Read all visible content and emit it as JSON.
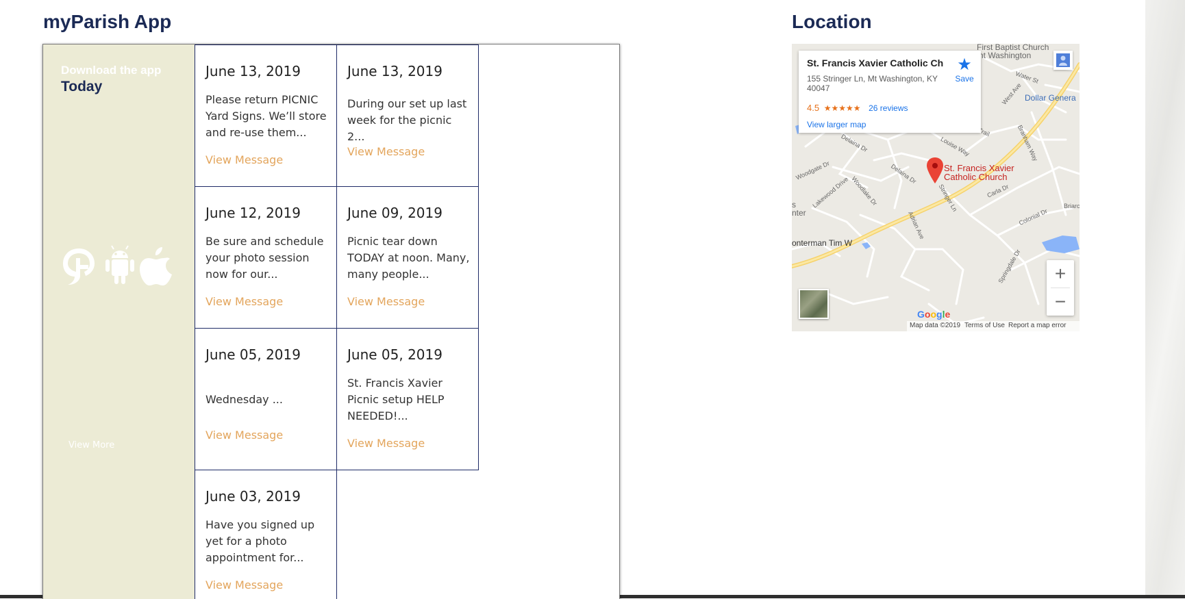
{
  "headings": {
    "app": "myParish App",
    "location": "Location"
  },
  "download": {
    "line1": "Download the app",
    "line2": "Today",
    "view_more": "View More"
  },
  "messages": [
    {
      "date": "June 13, 2019",
      "text": "Please return PICNIC Yard Signs. We’ll store and re-use them...",
      "link": "View Message"
    },
    {
      "date": "June 13, 2019",
      "text": "During our set up last week for the picnic 2...",
      "link": "View Message"
    },
    {
      "date": "June 12, 2019",
      "text": "Be sure and schedule your photo session now for our...",
      "link": "View Message"
    },
    {
      "date": "June 09, 2019",
      "text": "Picnic tear down TODAY at noon. Many, many people...",
      "link": "View Message"
    },
    {
      "date": "June 05, 2019",
      "text": "Wednesday ...",
      "link": "View Message"
    },
    {
      "date": "June 05, 2019",
      "text": "St. Francis Xavier Picnic setup HELP NEEDED!...",
      "link": "View Message"
    },
    {
      "date": "June 03, 2019",
      "text": "Have you signed up yet for a photo appointment for...",
      "link": "View Message"
    }
  ],
  "map": {
    "place_name": "St. Francis Xavier Catholic Ch...",
    "address": "155 Stringer Ln, Mt Washington, KY 40047",
    "rating": "4.5",
    "stars": "★★★★★",
    "reviews": "26 reviews",
    "larger_map": "View larger map",
    "save": "Save",
    "pin_label_line1": "St. Francis Xavier",
    "pin_label_line2": "Catholic Church",
    "zoom_in": "+",
    "zoom_out": "−",
    "footer_data": "Map data ©2019",
    "footer_terms": "Terms of Use",
    "footer_report": "Report a map error",
    "streets": {
      "first_baptist_1": "First Baptist Church",
      "first_baptist_2": "nt Washington",
      "dollar_general": "Dollar Genera",
      "water_st": "Water St",
      "west_ave": "West Ave",
      "trail": "Trail",
      "branham_way": "Branham Way",
      "louise_way": "Louise Way",
      "delaina_dr_1": "Delaina Dr",
      "delaina_dr_2": "Delaina Dr",
      "woodgate": "Woodgate Dr",
      "lakewood": "Lakewood Drive",
      "woodlake": "Woodlake Dr",
      "stringer_ln": "Stringer Ln",
      "carla_dr": "Carla Dr",
      "adrian_ave": "Adrian Ave",
      "colonial_dr": "Colonial Dr",
      "nter_1": "s",
      "nter_2": "nter",
      "oonterman": "onterman Tim W",
      "springdale": "Springdale Dr",
      "briar": "Briarc"
    }
  },
  "colors": {
    "heading": "#1b2a55",
    "panel": "#ecebd5",
    "link": "#e3a55c",
    "card_border": "#1e2a66"
  },
  "icons": [
    "presto-icon",
    "android-icon",
    "apple-icon",
    "star-icon",
    "pegman-icon",
    "map-pin-icon"
  ]
}
